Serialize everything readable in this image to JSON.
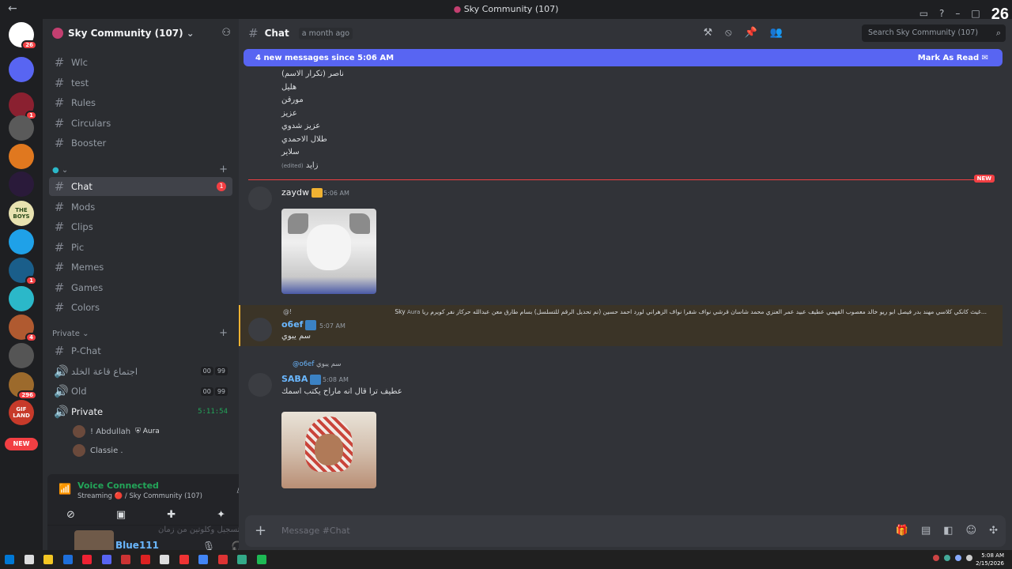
{
  "window": {
    "title": "Sky Community (107)",
    "corner_badge": "26"
  },
  "servers": [
    {
      "label": "",
      "badge": "26",
      "color": "#ffffff"
    },
    {
      "label": "",
      "badge": "",
      "color": "#5865f2"
    },
    {
      "label": "",
      "badge": "1",
      "color": "#8a2030"
    },
    {
      "label": "",
      "badge": "",
      "color": "#5a5a5a"
    },
    {
      "label": "",
      "badge": "",
      "color": "#e0781f"
    },
    {
      "label": "",
      "badge": "",
      "color": "#2a1a3a"
    },
    {
      "label": "THE BOYS",
      "badge": "",
      "color": "#e8e2b0"
    },
    {
      "label": "",
      "badge": "",
      "color": "#1fa1e8"
    },
    {
      "label": "",
      "badge": "1",
      "color": "#1a5e8a"
    },
    {
      "label": "",
      "badge": "",
      "color": "#2bb8c9"
    },
    {
      "label": "",
      "badge": "4",
      "color": "#b05a30"
    },
    {
      "label": "",
      "badge": "",
      "color": "#555"
    },
    {
      "label": "",
      "badge": "296",
      "color": "#9c6a2c"
    },
    {
      "label": "GIF LAND",
      "badge": "",
      "color": "#c73a2a"
    }
  ],
  "new_pill": "NEW",
  "sidebar": {
    "guild_name": "Sky Community (107)",
    "channels_top": [
      "Wlc",
      "test",
      "Rules",
      "Circulars",
      "Booster"
    ],
    "channels_main": [
      {
        "name": "Chat",
        "unread": "1",
        "active": true
      },
      {
        "name": "Mods"
      },
      {
        "name": "Clips"
      },
      {
        "name": "Pic"
      },
      {
        "name": "Memes"
      },
      {
        "name": "Games"
      },
      {
        "name": "Colors"
      }
    ],
    "private_category": "Private",
    "private_channels": [
      {
        "name": "P-Chat",
        "type": "text"
      },
      {
        "name": "اجتماع قاعة الخلد",
        "type": "voice",
        "c1": "00",
        "c2": "99"
      },
      {
        "name": "Old",
        "type": "voice",
        "c1": "00",
        "c2": "99"
      },
      {
        "name": "Private",
        "type": "voice-live",
        "time": "5:11:54"
      }
    ],
    "voice_users": [
      {
        "name": "! Abdullah",
        "tag": "Aura"
      },
      {
        "name": "Classie .",
        "tag": ""
      }
    ]
  },
  "voice_panel": {
    "title": "Voice Connected",
    "subtitle": "Streaming 🔴 / Sky Community (107)",
    "username": "Blue111",
    "ghost_text": "شكلتني تسجيل وكلوتين من زمان"
  },
  "channel": {
    "name": "Chat",
    "topic": "a month ago",
    "search_placeholder": "Search Sky Community (107)"
  },
  "new_messages_bar": {
    "text": "4 new messages since 5:06 AM",
    "action": "Mark As Read"
  },
  "list_lines": [
    "ناصر (تكرار الاسم)",
    "هليل",
    "مورقن",
    "عزيز",
    "عزيز شدوي",
    "طلال الاحمدي",
    "سلاير",
    "زايد"
  ],
  "edited_label": "(edited)",
  "new_divider": "NEW",
  "messages": [
    {
      "author": "zaydw",
      "time": "5:06 AM",
      "author_color": "#f2f3f5"
    },
    {
      "reply_prefix": "@!",
      "reply_user": "Sky",
      "reply_tag": "Aura",
      "reply_text": "غيث كانكي كلاسي مهند بدر فيصل ابو ريو خالد معصوب الفهمي عطيف عبيد عمر العنزي محمد شاسان قرشي نواف شقرا نواف الزهراني لورد احمد حسين (تم تحديل الرقم للتسلسل) بسام طارق معن عبدالله حركاز نفر كويرم ريا...",
      "author": "o6ef",
      "time": "5:07 AM",
      "text": "سم يبوي",
      "author_color": "#6ab7ff"
    },
    {
      "reply_prefix": "@o6ef",
      "reply_text": "سم يبوي",
      "author": "SABA",
      "time": "5:08 AM",
      "text": "عطيف ترا قال انه ماراح يكتب اسمك",
      "author_color": "#6ab7ff"
    }
  ],
  "composer": {
    "placeholder": "Message #Chat"
  },
  "clock": {
    "time": "5:08 AM",
    "date": "2/15/2026"
  }
}
